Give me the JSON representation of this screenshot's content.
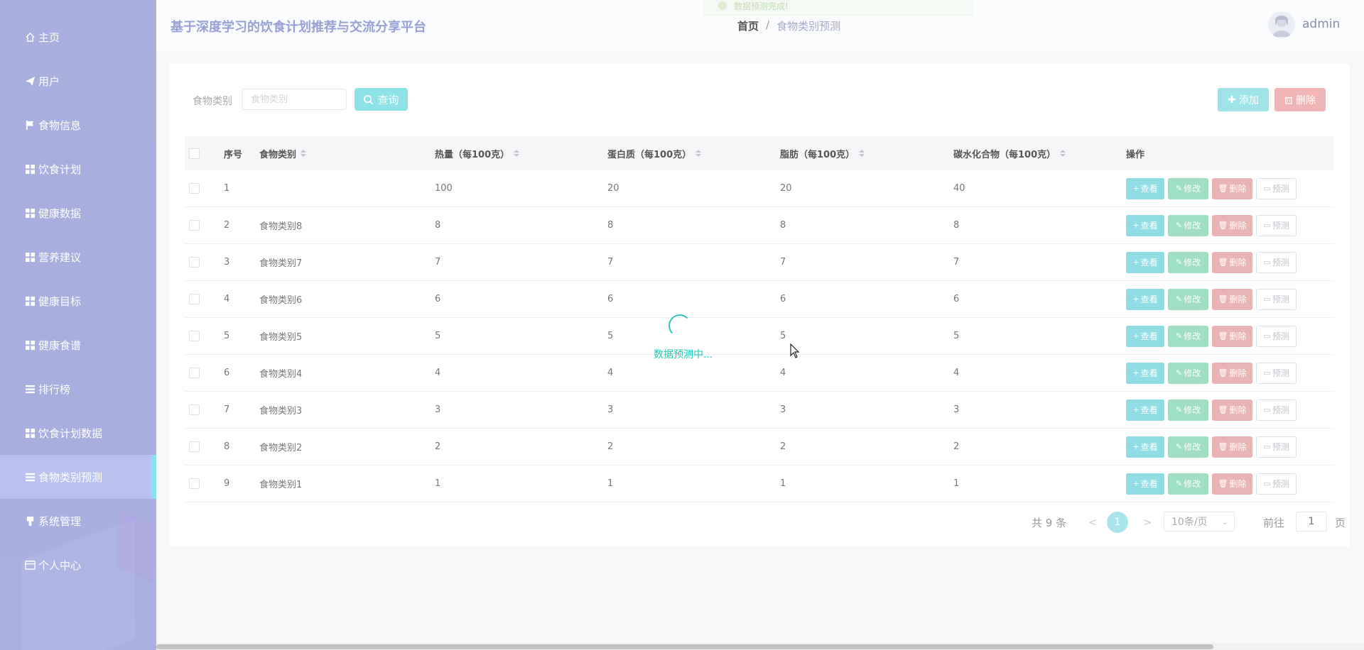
{
  "app": {
    "title": "基于深度学习的饮食计划推荐与交流分享平台",
    "username": "admin"
  },
  "toast": {
    "text": "数据预测完成!"
  },
  "breadcrumb": {
    "home": "首页",
    "separator": "/",
    "current": "食物类别预测"
  },
  "sidebar": {
    "items": [
      {
        "label": "主页",
        "icon": "home-icon"
      },
      {
        "label": "用户",
        "icon": "paper-plane-icon"
      },
      {
        "label": "食物信息",
        "icon": "flag-icon"
      },
      {
        "label": "饮食计划",
        "icon": "grid-icon"
      },
      {
        "label": "健康数据",
        "icon": "grid-icon"
      },
      {
        "label": "营养建议",
        "icon": "grid-icon"
      },
      {
        "label": "健康目标",
        "icon": "grid-icon"
      },
      {
        "label": "健康食谱",
        "icon": "grid-icon"
      },
      {
        "label": "排行榜",
        "icon": "list-icon"
      },
      {
        "label": "饮食计划数据",
        "icon": "grid-icon"
      },
      {
        "label": "食物类别预测",
        "icon": "list-icon",
        "active": true
      },
      {
        "label": "系统管理",
        "icon": "bookmark-icon"
      },
      {
        "label": "个人中心",
        "icon": "card-icon"
      }
    ]
  },
  "search": {
    "label": "食物类别",
    "placeholder": "食物类别",
    "button": "查询"
  },
  "toolbar": {
    "add": "添加",
    "delete": "删除"
  },
  "table": {
    "headers": [
      "序号",
      "食物类别",
      "热量（每100克）",
      "蛋白质（每100克）",
      "脂肪（每100克）",
      "碳水化合物（每100克）",
      "操作"
    ],
    "actions": {
      "view": "查看",
      "edit": "修改",
      "delete": "删除",
      "predict": "预测"
    },
    "rows": [
      [
        "1",
        "",
        "100",
        "20",
        "20",
        "40"
      ],
      [
        "2",
        "食物类别8",
        "8",
        "8",
        "8",
        "8"
      ],
      [
        "3",
        "食物类别7",
        "7",
        "7",
        "7",
        "7"
      ],
      [
        "4",
        "食物类别6",
        "6",
        "6",
        "6",
        "6"
      ],
      [
        "5",
        "食物类别5",
        "5",
        "5",
        "5",
        "5"
      ],
      [
        "6",
        "食物类别4",
        "4",
        "4",
        "4",
        "4"
      ],
      [
        "7",
        "食物类别3",
        "3",
        "3",
        "3",
        "3"
      ],
      [
        "8",
        "食物类别2",
        "2",
        "2",
        "2",
        "2"
      ],
      [
        "9",
        "食物类别1",
        "1",
        "1",
        "1",
        "1"
      ]
    ]
  },
  "pagination": {
    "total": "共 9 条",
    "prev": "<",
    "current": "1",
    "next": ">",
    "page_size": "10条/页",
    "goto": "前往",
    "goto_value": "1",
    "page_suffix": "页"
  },
  "loading": {
    "text": "数据预测中..."
  },
  "colors": {
    "sidebar": "#a9b0df",
    "accent": "#8ee1e6",
    "danger": "#f2b5b5",
    "loading": "#20c7b0"
  }
}
